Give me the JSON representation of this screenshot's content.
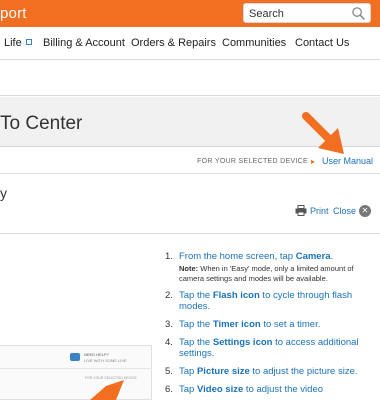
{
  "header": {
    "brand_fragment": "port",
    "search": {
      "placeholder": "Search",
      "icon": "search-icon"
    },
    "colors": {
      "brand": "#f26f21",
      "link": "#1b72b9"
    }
  },
  "nav": {
    "items": [
      {
        "label": "Life",
        "icon": "external-link-icon"
      },
      {
        "label": "Billing & Account"
      },
      {
        "label": "Orders & Repairs"
      },
      {
        "label": "Communities"
      },
      {
        "label": "Contact Us"
      }
    ]
  },
  "page": {
    "title": "To Center",
    "section_heading_fragment": "y"
  },
  "device_bar": {
    "label": "FOR YOUR SELECTED DEVICE",
    "separator": "▸",
    "user_manual_link": "User Manual"
  },
  "tools": {
    "print_label": "Print",
    "close_label": "Close",
    "close_icon_glyph": "✕"
  },
  "steps": [
    {
      "number": "1.",
      "pre": "From the home screen, tap ",
      "bold": "Camera",
      "post": ".",
      "note_label": "Note:",
      "note": " When in 'Easy' mode, only a limited amount of camera settings and modes will be available."
    },
    {
      "number": "2.",
      "pre": "Tap the ",
      "bold": "Flash icon",
      "post": " to cycle through flash modes."
    },
    {
      "number": "3.",
      "pre": "Tap the ",
      "bold": "Timer icon",
      "post": " to set a timer."
    },
    {
      "number": "4.",
      "pre": "Tap the ",
      "bold": "Settings icon",
      "post": " to access additional settings."
    },
    {
      "number": "5.",
      "pre": "Tap ",
      "bold": "Picture size",
      "post": " to adjust the picture size."
    },
    {
      "number": "6.",
      "pre": "Tap ",
      "bold": "Video size",
      "post": " to adjust the video"
    }
  ],
  "thumbnail": {
    "line1": "NEED HELP?",
    "line2": "LIVE WITH SOME LIVE",
    "line3": "FOR YOUR SELECTED DEVICE"
  }
}
